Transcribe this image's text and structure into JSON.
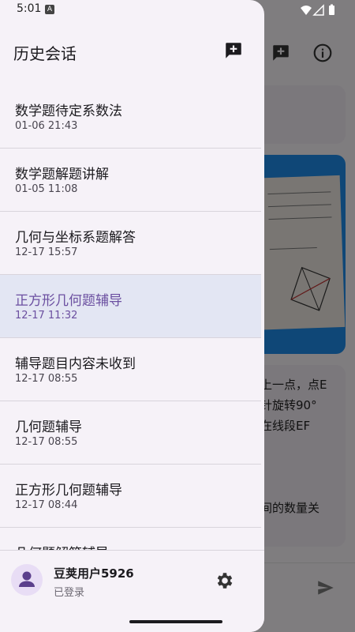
{
  "status_bar": {
    "time": "5:01",
    "notification_glyph": "A"
  },
  "drawer": {
    "title": "历史会话",
    "new_chat_icon": "add-comment-icon",
    "sessions": [
      {
        "title": "数学题待定系数法",
        "time": "01-06 21:43",
        "selected": false
      },
      {
        "title": "数学题解题讲解",
        "time": "01-05 11:08",
        "selected": false
      },
      {
        "title": "几何与坐标系题解答",
        "time": "12-17 15:57",
        "selected": false
      },
      {
        "title": "正方形几何题辅导",
        "time": "12-17 11:32",
        "selected": true
      },
      {
        "title": "辅导题目内容未收到",
        "time": "12-17 08:55",
        "selected": false
      },
      {
        "title": "几何题辅导",
        "time": "12-17 08:55",
        "selected": false
      },
      {
        "title": "正方形几何题辅导",
        "time": "12-17 08:44",
        "selected": false
      },
      {
        "title": "几何题解答辅导",
        "time": "",
        "selected": false
      }
    ],
    "footer": {
      "user_name": "豆荚用户5926",
      "user_status": "已登录",
      "avatar_icon": "person-icon",
      "settings_icon": "gear-icon"
    }
  },
  "background_chat": {
    "message_lines": [
      "上一点，点E",
      "针旋转90°",
      "在线段EF",
      "间的数量关"
    ]
  },
  "colors": {
    "accent": "#6b4fa0",
    "selected_bg": "#e3e6f3",
    "drawer_bg": "#f6f2f8",
    "image_card": "#1e88e5"
  }
}
